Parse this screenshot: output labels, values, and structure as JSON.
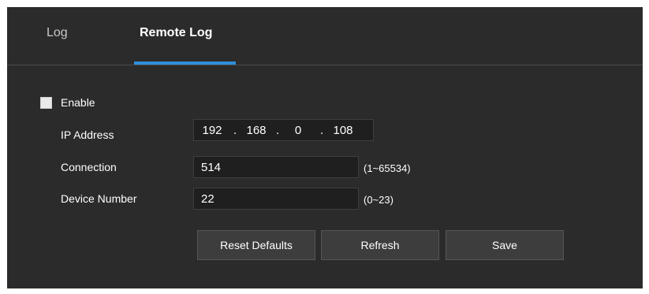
{
  "tabs": {
    "log": "Log",
    "remote_log": "Remote Log",
    "active": "Remote Log"
  },
  "form": {
    "enable": {
      "label": "Enable",
      "checked": false
    },
    "ip_address": {
      "label": "IP Address",
      "seg1": "192",
      "seg2": "168",
      "seg3": "0",
      "seg4": "108",
      "dot": "."
    },
    "connection": {
      "label": "Connection",
      "value": "514",
      "hint": "(1~65534)"
    },
    "device_number": {
      "label": "Device Number",
      "value": "22",
      "hint": "(0~23)"
    }
  },
  "buttons": {
    "reset": "Reset Defaults",
    "refresh": "Refresh",
    "save": "Save"
  },
  "colors": {
    "panel_bg": "#2b2b2b",
    "accent": "#2f8fd8",
    "field_bg": "#1f1f1f",
    "button_bg": "#3d3d3d"
  }
}
